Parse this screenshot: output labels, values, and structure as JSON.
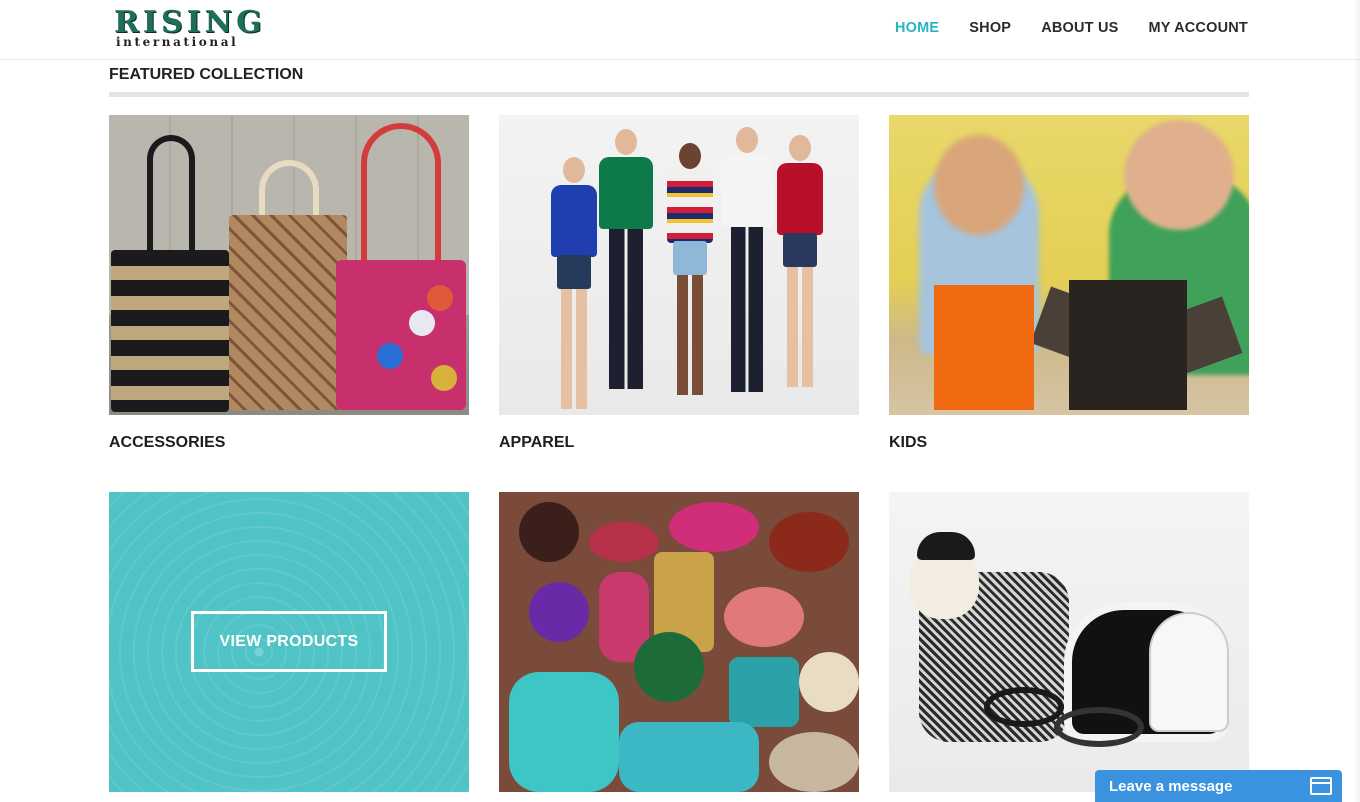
{
  "brand": {
    "main": "RISING",
    "sub": "international"
  },
  "nav": {
    "items": [
      {
        "label": "HOME",
        "active": true
      },
      {
        "label": "SHOP",
        "active": false
      },
      {
        "label": "ABOUT US",
        "active": false
      },
      {
        "label": "MY ACCOUNT",
        "active": false
      }
    ]
  },
  "section": {
    "title": "FEATURED COLLECTION"
  },
  "tiles": {
    "accessories": {
      "label": "ACCESSORIES"
    },
    "apparel": {
      "label": "APPAREL"
    },
    "kids": {
      "label": "KIDS"
    },
    "view": {
      "button": "VIEW PRODUCTS"
    }
  },
  "chat": {
    "label": "Leave a message"
  },
  "colors": {
    "accent": "#2bb3c0",
    "overlay": "#50c3c7",
    "chat": "#3b93e0"
  }
}
